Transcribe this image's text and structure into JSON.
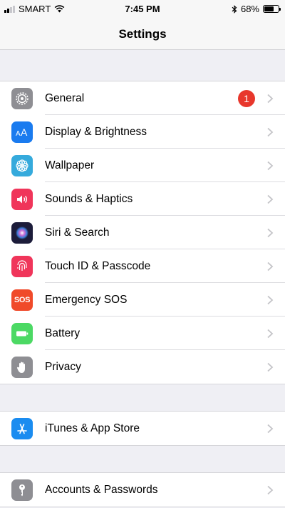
{
  "status_bar": {
    "carrier": "SMART",
    "time": "7:45 PM",
    "battery_percent": "68%",
    "battery_level": 0.68,
    "signal_bars": 2
  },
  "nav": {
    "title": "Settings"
  },
  "groups": [
    {
      "rows": [
        {
          "label": "General",
          "icon": "gear-icon",
          "color": "#8e8e93",
          "badge": "1"
        },
        {
          "label": "Display & Brightness",
          "icon": "text-size-icon",
          "color": "#1a7bef"
        },
        {
          "label": "Wallpaper",
          "icon": "flower-icon",
          "color": "#35aadc"
        },
        {
          "label": "Sounds & Haptics",
          "icon": "speaker-icon",
          "color": "#f0355a"
        },
        {
          "label": "Siri & Search",
          "icon": "siri-icon",
          "color": "#1c1c3a"
        },
        {
          "label": "Touch ID & Passcode",
          "icon": "fingerprint-icon",
          "color": "#f0355a"
        },
        {
          "label": "Emergency SOS",
          "icon": "sos-icon",
          "color": "#f04a2a",
          "icon_text": "SOS"
        },
        {
          "label": "Battery",
          "icon": "battery-icon",
          "color": "#4cd964"
        },
        {
          "label": "Privacy",
          "icon": "hand-icon",
          "color": "#8e8e93"
        }
      ]
    },
    {
      "rows": [
        {
          "label": "iTunes & App Store",
          "icon": "app-store-icon",
          "color": "#1a8cf0"
        }
      ]
    },
    {
      "rows": [
        {
          "label": "Accounts & Passwords",
          "icon": "key-icon",
          "color": "#8e8e93"
        }
      ]
    }
  ]
}
